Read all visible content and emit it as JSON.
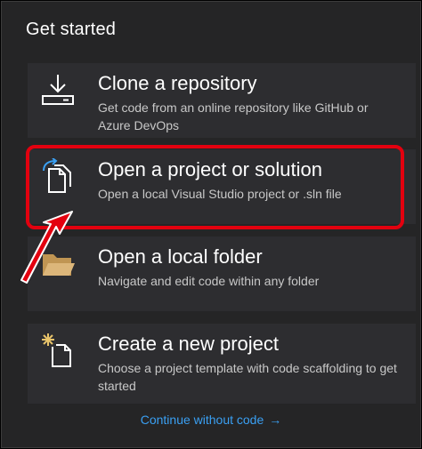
{
  "panel": {
    "heading": "Get started"
  },
  "cards": [
    {
      "title": "Clone a repository",
      "description": "Get code from an online repository like GitHub or Azure DevOps",
      "icon": "download-icon"
    },
    {
      "title": "Open a project or solution",
      "description": "Open a local Visual Studio project or .sln file",
      "icon": "open-project-icon"
    },
    {
      "title": "Open a local folder",
      "description": "Navigate and edit code within any folder",
      "icon": "folder-icon"
    },
    {
      "title": "Create a new project",
      "description": "Choose a project template with code scaffolding to get started",
      "icon": "new-project-icon"
    }
  ],
  "footer": {
    "continue_label": "Continue without code",
    "continue_arrow": "→"
  },
  "colors": {
    "background": "#252526",
    "card": "#2d2d30",
    "link": "#3aa0f3",
    "annotation": "#e3000f"
  }
}
